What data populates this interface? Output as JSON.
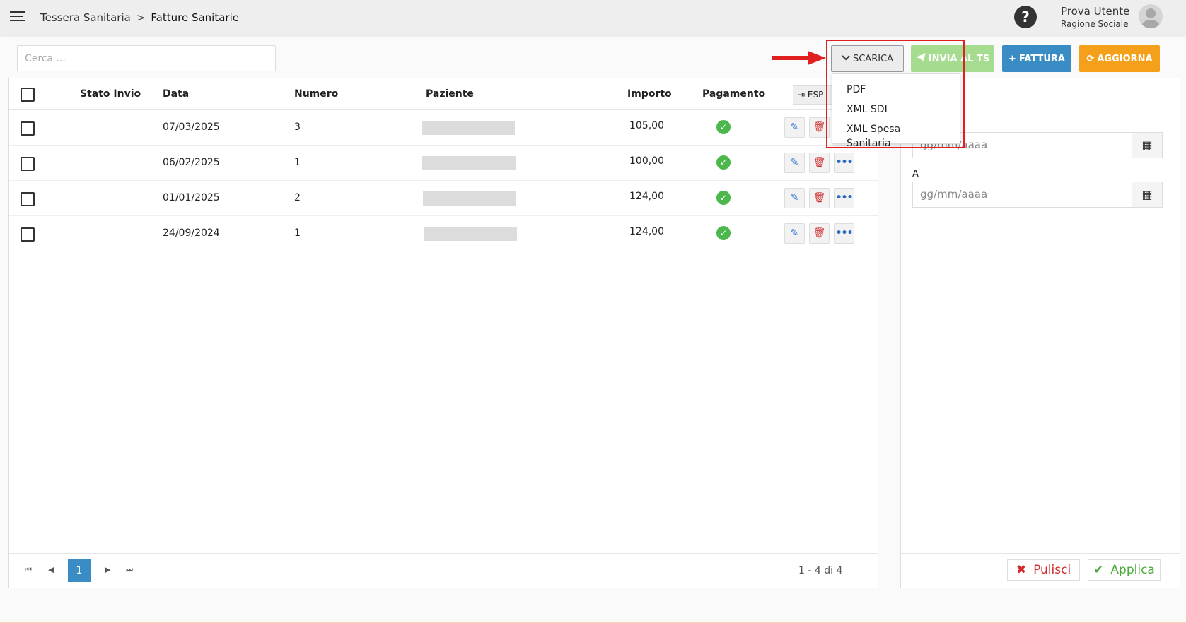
{
  "breadcrumb": {
    "root": "Tessera Sanitaria",
    "separator": ">",
    "current": "Fatture Sanitarie"
  },
  "user": {
    "name": "Prova Utente",
    "company": "Ragione Sociale"
  },
  "help": "?",
  "search": {
    "placeholder": "Cerca ..."
  },
  "toolbar": {
    "scarica_label": "SCARICA",
    "invia_label": "INVIA AL TS",
    "fattura_label": "FATTURA",
    "aggiorna_label": "AGGIORNA"
  },
  "dropdown": {
    "items": [
      "PDF",
      "XML SDI",
      "XML Spesa Sanitaria"
    ]
  },
  "table": {
    "headers": {
      "stato": "Stato Invio",
      "data": "Data",
      "numero": "Numero",
      "paziente": "Paziente",
      "importo": "Importo",
      "pagamento": "Pagamento",
      "export": "ESP"
    },
    "rows": [
      {
        "data": "07/03/2025",
        "numero": "3",
        "importo": "105,00"
      },
      {
        "data": "06/02/2025",
        "numero": "1",
        "importo": "100,00"
      },
      {
        "data": "01/01/2025",
        "numero": "2",
        "importo": "124,00"
      },
      {
        "data": "24/09/2024",
        "numero": "1",
        "importo": "124,00"
      }
    ]
  },
  "pager": {
    "current": "1",
    "info": "1 - 4 di 4"
  },
  "filters": {
    "date_placeholder": "gg/mm/aaaa",
    "label_a": "A",
    "pulisci": "Pulisci",
    "applica": "Applica"
  },
  "colors": {
    "accent_blue": "#3a8dc4",
    "orange": "#f5a01a",
    "green_disabled": "#a5dc90",
    "highlight_red": "#e02020"
  }
}
